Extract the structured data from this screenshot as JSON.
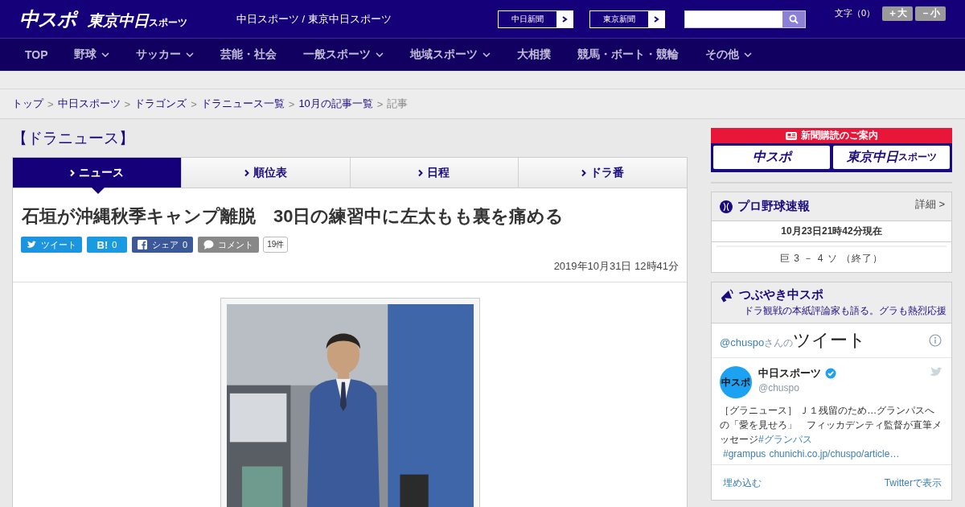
{
  "header": {
    "logo_main": "中スポ",
    "logo_tokyo": "東京中日",
    "logo_tokyo_sub": "スポーツ",
    "site_title": "中日スポーツ / 東京中日スポーツ",
    "paper_links": [
      {
        "label": "中日新聞"
      },
      {
        "label": "東京新聞"
      }
    ],
    "font_size": {
      "label": "文字（0）",
      "buttons": [
        "＋大",
        "－小"
      ]
    }
  },
  "nav": [
    {
      "label": "TOP",
      "dropdown": false
    },
    {
      "label": "野球",
      "dropdown": true
    },
    {
      "label": "サッカー",
      "dropdown": true
    },
    {
      "label": "芸能・社会",
      "dropdown": false
    },
    {
      "label": "一般スポーツ",
      "dropdown": true
    },
    {
      "label": "地域スポーツ",
      "dropdown": true
    },
    {
      "label": "大相撲",
      "dropdown": false
    },
    {
      "label": "競馬・ボート・競輪",
      "dropdown": false
    },
    {
      "label": "その他",
      "dropdown": true
    }
  ],
  "breadcrumb": {
    "separator": ">",
    "items": [
      {
        "label": "トップ",
        "link": true
      },
      {
        "label": "中日スポーツ",
        "link": true
      },
      {
        "label": "ドラゴンズ",
        "link": true
      },
      {
        "label": "ドラニュース一覧",
        "link": true
      },
      {
        "label": "10月の記事一覧",
        "link": true
      },
      {
        "label": "記事",
        "link": false
      }
    ]
  },
  "section_title": "【ドラニュース】",
  "tabs": [
    {
      "label": "ニュース",
      "selected": true
    },
    {
      "label": "順位表",
      "selected": false
    },
    {
      "label": "日程",
      "selected": false
    },
    {
      "label": "ドラ番",
      "selected": false
    }
  ],
  "article": {
    "title": "石垣が沖縄秋季キャンプ離脱　30日の練習中に左太もも裏を痛める",
    "share": [
      {
        "kind": "twitter",
        "label": "ツイート"
      },
      {
        "kind": "hatena",
        "label": "B!",
        "count": "0"
      },
      {
        "kind": "facebook",
        "label": "シェア",
        "count": "0"
      },
      {
        "kind": "comment",
        "label": "コメント",
        "count": "19件"
      }
    ],
    "date": "2019年10月31日 12時41分"
  },
  "sidebar": {
    "subscribe": {
      "title": "新聞購読のご案内",
      "logos": [
        {
          "main": "中スポ"
        },
        {
          "main": "東京中日",
          "sub": "スポーツ"
        }
      ]
    },
    "scores": {
      "title": "プロ野球速報",
      "detail": "詳細 >",
      "updated": "10月23日21時42分現在",
      "games": [
        "巨 3 － 4 ソ （終了）"
      ]
    },
    "tweets": {
      "title": "つぶやき中スポ",
      "subtitle": "ドラ観戦の本紙評論家も語る。グラも熱烈応援",
      "handle": "@chuspo",
      "handle_suffix": "さんの",
      "heading": "ツイート",
      "tweet": {
        "avatar_label": "中スポ",
        "name": "中日スポーツ",
        "verified": true,
        "user": "@chuspo",
        "parts": [
          {
            "kind": "text",
            "text": "［グラニュース］ Ｊ１残留のため…グランパスへの「愛を見せろ」　フィッカデンティ監督が直筆メッセージ"
          },
          {
            "kind": "link",
            "text": "#グランパス"
          },
          {
            "kind": "link",
            "text": "#grampus"
          },
          {
            "kind": "link",
            "text": "chunichi.co.jp/chuspo/article…"
          }
        ]
      },
      "embed": "埋め込む",
      "view": "Twitterで表示"
    }
  }
}
